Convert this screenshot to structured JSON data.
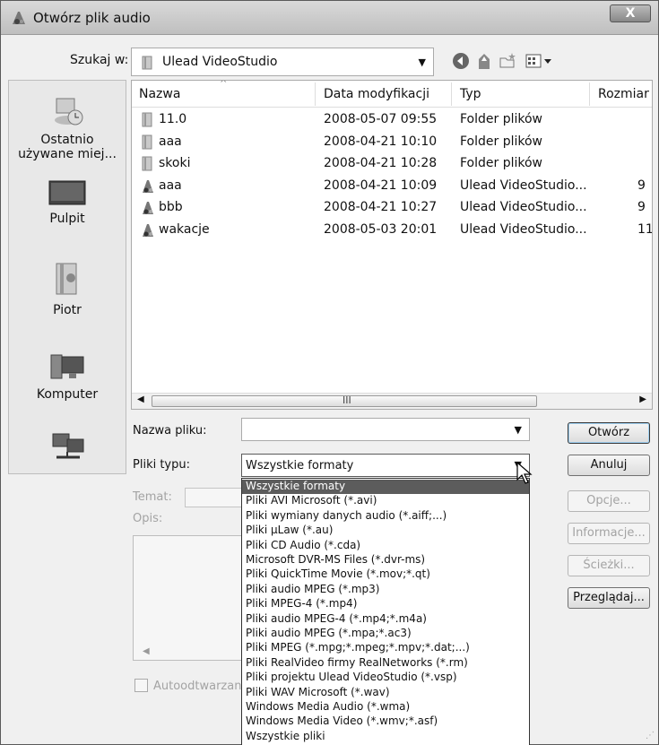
{
  "window": {
    "title": "Otwórz plik audio",
    "close_label": "X"
  },
  "lookin": {
    "label": "Szukaj w:",
    "value": "Ulead VideoStudio"
  },
  "toolbar": {
    "back_icon": "back-icon",
    "up_icon": "up-folder-icon",
    "new_folder_icon": "new-folder-icon",
    "views_icon": "views-menu-icon"
  },
  "places": [
    {
      "label": "Ostatnio\nużywane miej...",
      "icon": "recent-places-icon"
    },
    {
      "label": "Pulpit",
      "icon": "desktop-icon"
    },
    {
      "label": "Piotr",
      "icon": "user-folder-icon"
    },
    {
      "label": "Komputer",
      "icon": "computer-icon"
    },
    {
      "label": "",
      "icon": "network-icon"
    }
  ],
  "columns": [
    "Nazwa",
    "Data modyfikacji",
    "Typ",
    "Rozmiar"
  ],
  "files": [
    {
      "name": "11.0",
      "date": "2008-05-07 09:55",
      "type": "Folder plików",
      "size": "",
      "icon": "folder"
    },
    {
      "name": "aaa",
      "date": "2008-04-21 10:10",
      "type": "Folder plików",
      "size": "",
      "icon": "folder"
    },
    {
      "name": "skoki",
      "date": "2008-04-21 10:28",
      "type": "Folder plików",
      "size": "",
      "icon": "folder"
    },
    {
      "name": "aaa",
      "date": "2008-04-21 10:09",
      "type": "Ulead VideoStudio...",
      "size": "9",
      "icon": "project"
    },
    {
      "name": "bbb",
      "date": "2008-04-21 10:27",
      "type": "Ulead VideoStudio...",
      "size": "9",
      "icon": "project"
    },
    {
      "name": "wakacje",
      "date": "2008-05-03 20:01",
      "type": "Ulead VideoStudio...",
      "size": "11",
      "icon": "project"
    }
  ],
  "scrollbar_grip": "III",
  "form": {
    "filename_label": "Nazwa pliku:",
    "filename_value": "",
    "filetype_label": "Pliki typu:",
    "filetype_value": "Wszystkie formaty",
    "subject_label": "Temat:",
    "description_label": "Opis:",
    "autoplay_label": "Autoodtwarzanie"
  },
  "buttons": {
    "open": "Otwórz",
    "cancel": "Anuluj",
    "options": "Opcje...",
    "info": "Informacje...",
    "paths": "Ścieżki...",
    "browse": "Przeglądaj..."
  },
  "filetype_options": [
    "Wszystkie formaty",
    "Pliki AVI Microsoft (*.avi)",
    "Pliki wymiany danych audio (*.aiff;...)",
    "Pliki µLaw (*.au)",
    "Pliki CD Audio (*.cda)",
    "Microsoft DVR-MS Files (*.dvr-ms)",
    "Pliki QuickTime Movie (*.mov;*.qt)",
    "Pliki audio MPEG (*.mp3)",
    "Pliki MPEG-4 (*.mp4)",
    "Pliki audio MPEG-4 (*.mp4;*.m4a)",
    "Pliki audio MPEG (*.mpa;*.ac3)",
    "Pliki MPEG (*.mpg;*.mpeg;*.mpv;*.dat;...)",
    "Pliki RealVideo firmy RealNetworks (*.rm)",
    "Pliki projektu Ulead VideoStudio (*.vsp)",
    "Pliki WAV Microsoft (*.wav)",
    "Windows Media Audio (*.wma)",
    "Windows Media Video (*.wmv;*.asf)",
    "Wszystkie pliki"
  ],
  "selected_option_index": 0
}
